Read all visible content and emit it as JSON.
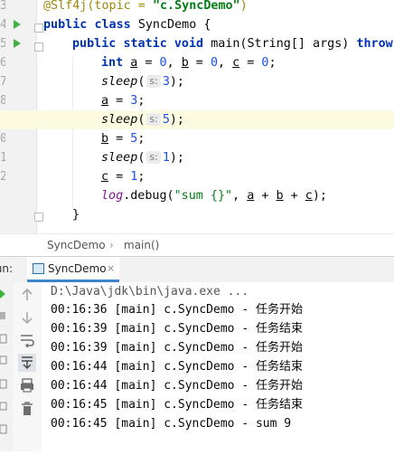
{
  "editor": {
    "line_numbers": [
      "3",
      "4",
      "5",
      "6",
      "7",
      "8",
      "9",
      "0",
      "1",
      "2"
    ],
    "lines": {
      "l1": {
        "annotation": "@Slf4j(topic = ",
        "annotation_value": "\"c.SyncDemo\"",
        "annotation_end": ")"
      },
      "l2": {
        "kw_public": "public",
        "kw_class": "class",
        "name": "SyncDemo {"
      },
      "l3": {
        "kw_public": "public",
        "kw_static": "static",
        "kw_void": "void",
        "sig": "main(String[] args)",
        "throws": "throws"
      },
      "l4": {
        "kw_int": "int",
        "a": "a",
        "eq0a": " = ",
        "zero1": "0",
        "sep1": ", ",
        "b": "b",
        "eq0b": " = ",
        "zero2": "0",
        "sep2": ", ",
        "c": "c",
        "eq0c": " = ",
        "zero3": "0",
        "end": ";"
      },
      "l5": {
        "fn": "sleep",
        "open": "(",
        "hint": "s:",
        "arg": "3",
        "close": ");"
      },
      "l6": {
        "var": "a",
        "eq": " = ",
        "val": "3",
        "end": ";"
      },
      "l7": {
        "fn": "sleep",
        "open": "(",
        "hint": "s:",
        "arg": "5",
        "close": ");"
      },
      "l8": {
        "var": "b",
        "eq": " = ",
        "val": "5",
        "end": ";"
      },
      "l9": {
        "fn": "sleep",
        "open": "(",
        "hint": "s:",
        "arg": "1",
        "close": ");"
      },
      "l10": {
        "var": "c",
        "eq": " = ",
        "val": "1",
        "end": ";"
      },
      "l11": {
        "log": "log",
        "call": ".debug(",
        "str": "\"sum {}\"",
        "comma": ", ",
        "a": "a",
        "plus1": " + ",
        "b": "b",
        "plus2": " + ",
        "c": "c",
        "end": ");"
      },
      "l12": {
        "brace": "}"
      }
    }
  },
  "breadcrumb": {
    "class": "SyncDemo",
    "sep": "›",
    "method": "main()"
  },
  "run_window": {
    "label": "Run:",
    "tab_label": "SyncDemo",
    "tab_close": "×"
  },
  "console": {
    "lines": [
      "D:\\Java\\jdk\\bin\\java.exe ...",
      "00:16:36 [main] c.SyncDemo - 任务开始",
      "00:16:39 [main] c.SyncDemo - 任务结束",
      "00:16:39 [main] c.SyncDemo - 任务开始",
      "00:16:44 [main] c.SyncDemo - 任务结束",
      "00:16:44 [main] c.SyncDemo - 任务开始",
      "00:16:45 [main] c.SyncDemo - 任务结束",
      "00:16:45 [main] c.SyncDemo - sum 9"
    ]
  },
  "colors": {
    "keyword": "#0033b3",
    "string": "#067d17",
    "number": "#1750eb",
    "annotation": "#9e880d",
    "run_green": "#3eb33e",
    "highlight_line": "#fcfae1"
  }
}
